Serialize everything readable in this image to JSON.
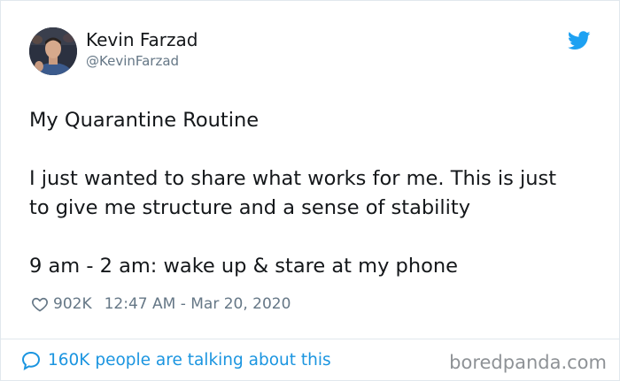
{
  "author": {
    "name": "Kevin Farzad",
    "handle": "@KevinFarzad"
  },
  "tweet": {
    "lines": [
      "My Quarantine Routine",
      "I just wanted to share what works for me. This is just",
      "to give me structure and a sense of stability",
      "9 am - 2 am: wake up & stare at my phone"
    ],
    "likes": "902K",
    "timestamp": "12:47 AM - Mar 20, 2020"
  },
  "footer": {
    "talking": "160K people are talking about this"
  },
  "watermark": "boredpanda.com",
  "icons": {
    "bird": "twitter-bird-icon",
    "heart": "heart-icon",
    "bubble": "speech-bubble-icon"
  },
  "colors": {
    "twitter_blue": "#1da1f2",
    "link_blue": "#1b95e0",
    "text": "#14171a",
    "muted": "#657786",
    "border": "#e1e8ed",
    "watermark": "#8e9296"
  }
}
